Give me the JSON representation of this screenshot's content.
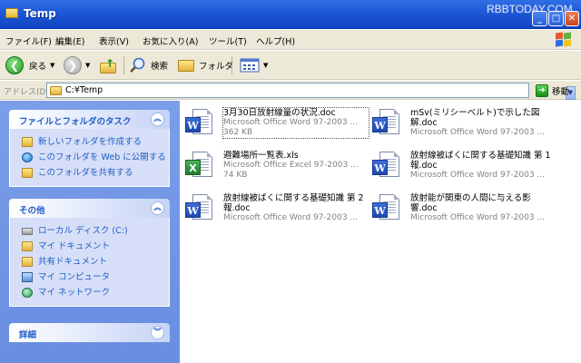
{
  "window": {
    "title": "Temp",
    "watermark": "RBBTODAY.COM",
    "min_label": "_",
    "max_label": "□",
    "close_label": "✕"
  },
  "menu": {
    "items": [
      {
        "label": "ファイル(F)"
      },
      {
        "label": "編集(E)"
      },
      {
        "label": "表示(V)"
      },
      {
        "label": "お気に入り(A)"
      },
      {
        "label": "ツール(T)"
      },
      {
        "label": "ヘルプ(H)"
      }
    ]
  },
  "toolbar": {
    "back_label": "戻る",
    "search_label": "検索",
    "folders_label": "フォルダ"
  },
  "address": {
    "label": "アドレス(D)",
    "value": "C:¥Temp",
    "go_label": "移動"
  },
  "tasks_panel": {
    "title": "ファイルとフォルダのタスク",
    "items": [
      {
        "label": "新しいフォルダを作成する",
        "icon": "new-folder-icon"
      },
      {
        "label": "このフォルダを Web に公開する",
        "icon": "globe-icon"
      },
      {
        "label": "このフォルダを共有する",
        "icon": "share-folder-icon"
      }
    ]
  },
  "other_panel": {
    "title": "その他",
    "items": [
      {
        "label": "ローカル ディスク (C:)",
        "icon": "drive-icon"
      },
      {
        "label": "マイ ドキュメント",
        "icon": "documents-folder-icon"
      },
      {
        "label": "共有ドキュメント",
        "icon": "shared-folder-icon"
      },
      {
        "label": "マイ コンピュータ",
        "icon": "computer-icon"
      },
      {
        "label": "マイ ネットワーク",
        "icon": "network-icon"
      }
    ]
  },
  "details_panel": {
    "title": "詳細"
  },
  "files": [
    {
      "name": "3月30日放射線量の状況.doc",
      "type": "Microsoft Office Word 97-2003 ...",
      "size": "362 KB",
      "kind": "word"
    },
    {
      "name": "mSv(ミリシーベルト)で示した図解.doc",
      "type": "Microsoft Office Word 97-2003 ...",
      "size": "",
      "kind": "word"
    },
    {
      "name": "避難場所一覧表.xls",
      "type": "Microsoft Office Excel 97-2003 ...",
      "size": "74 KB",
      "kind": "excel"
    },
    {
      "name": "放射線被ばくに関する基礎知識 第 1 報.doc",
      "type": "Microsoft Office Word 97-2003 ...",
      "size": "",
      "kind": "word"
    },
    {
      "name": "放射線被ばくに関する基礎知識 第 2 報.doc",
      "type": "Microsoft Office Word 97-2003 ...",
      "size": "",
      "kind": "word"
    },
    {
      "name": "放射能が関東の人間に与える影響.doc",
      "type": "Microsoft Office Word 97-2003 ...",
      "size": "",
      "kind": "word"
    }
  ]
}
